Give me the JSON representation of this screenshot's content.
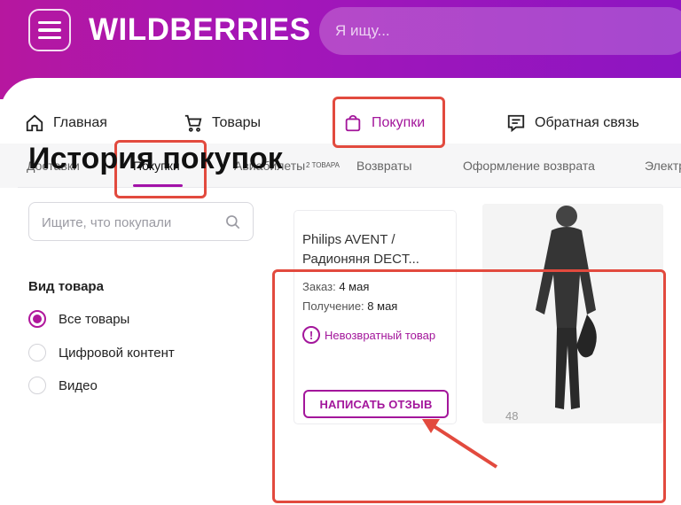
{
  "header": {
    "logo": "WILDBERRIES",
    "search_placeholder": "Я ищу..."
  },
  "nav": [
    {
      "label": "Главная",
      "icon": "home-icon"
    },
    {
      "label": "Товары",
      "icon": "cart-icon"
    },
    {
      "label": "Покупки",
      "icon": "bag-icon"
    },
    {
      "label": "Обратная связь",
      "icon": "feedback-icon"
    }
  ],
  "subnav": [
    "Доставки",
    "Покупки",
    "Авиабилеты",
    "Возвраты",
    "Оформление возврата",
    "Электр"
  ],
  "page": {
    "title": "История покупок",
    "count": "2 ТОВАРА"
  },
  "filter": {
    "search_placeholder": "Ищите, что покупали",
    "group_title": "Вид товара",
    "options": [
      {
        "label": "Все товары",
        "selected": true
      },
      {
        "label": "Цифровой контент",
        "selected": false
      },
      {
        "label": "Видео",
        "selected": false
      }
    ]
  },
  "product": {
    "name_line1": "Philips AVENT /",
    "name_line2": "Радионяня DECT...",
    "order_label": "Заказ:",
    "order_date": "4 мая",
    "receive_label": "Получение:",
    "receive_date": "8 мая",
    "warning": "Невозвратный товар",
    "review_button": "НАПИСАТЬ ОТЗЫВ"
  },
  "second_product": {
    "number": "48"
  },
  "colors": {
    "accent": "#a3169b",
    "annotation": "#e24a3e"
  }
}
